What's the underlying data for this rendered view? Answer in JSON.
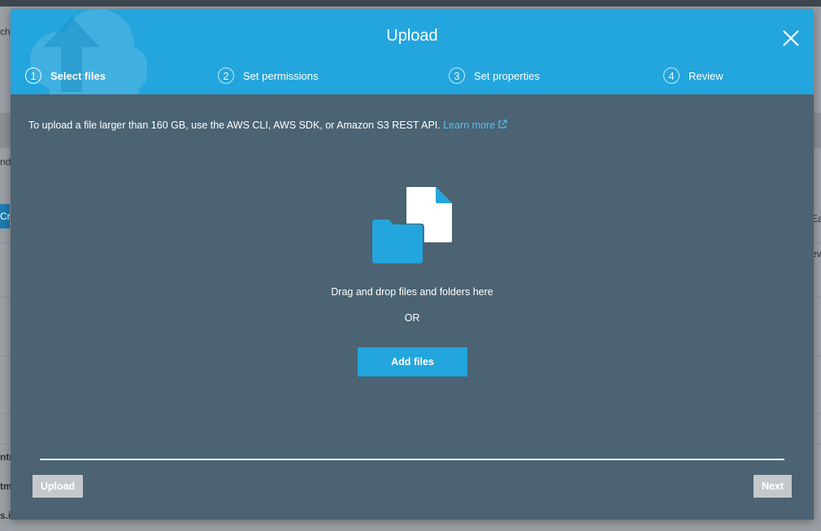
{
  "background": {
    "fragments": [
      "ch",
      "nd",
      "Cr",
      "Ea",
      "ev",
      "ntr",
      "tm",
      "s.i"
    ]
  },
  "modal": {
    "title": "Upload",
    "steps": [
      {
        "number": "1",
        "label": "Select files",
        "active": true
      },
      {
        "number": "2",
        "label": "Set permissions",
        "active": false
      },
      {
        "number": "3",
        "label": "Set properties",
        "active": false
      },
      {
        "number": "4",
        "label": "Review",
        "active": false
      }
    ],
    "notice_text": "To upload a file larger than 160 GB, use the AWS CLI, AWS SDK, or Amazon S3 REST API.",
    "learn_more": "Learn more",
    "drop_text": "Drag and drop files and folders here",
    "or_text": "OR",
    "add_files": "Add files",
    "upload_button": "Upload",
    "next_button": "Next"
  },
  "colors": {
    "header": "#23a5dd",
    "body": "#4b6373",
    "link": "#4fc3f7",
    "disabled_button": "#c5c8cb"
  },
  "icons": {
    "close": "close-icon",
    "external_link": "external-link-icon",
    "drop": "folder-file-icon",
    "logo": "cloud-upload-icon"
  }
}
